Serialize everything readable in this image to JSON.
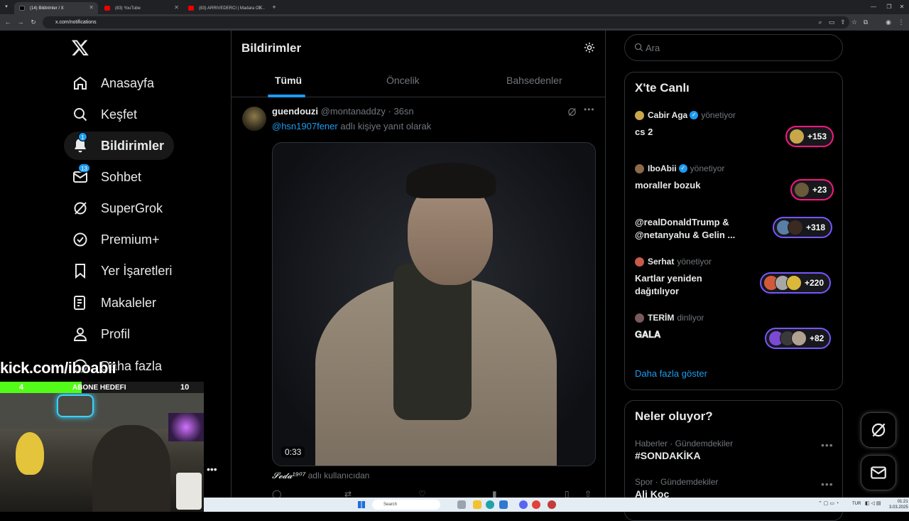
{
  "browser": {
    "tabs": [
      {
        "title": "(14) Bildirimler / X"
      },
      {
        "title": "(83) YouTube"
      },
      {
        "title": "(83) ARRIVEDERCI | Madara OL..."
      }
    ],
    "url": "x.com/notifications"
  },
  "nav": {
    "logo": "X",
    "items": [
      {
        "label": "Anasayfa"
      },
      {
        "label": "Keşfet"
      },
      {
        "label": "Bildirimler",
        "badge": "1"
      },
      {
        "label": "Sohbet",
        "badge": "13"
      },
      {
        "label": "SuperGrok"
      },
      {
        "label": "Premium+"
      },
      {
        "label": "Yer İşaretleri"
      },
      {
        "label": "Makaleler"
      },
      {
        "label": "Profil"
      },
      {
        "label": "Daha fazla"
      }
    ]
  },
  "header": {
    "title": "Bildirimler",
    "tabs": [
      {
        "label": "Tümü"
      },
      {
        "label": "Öncelik"
      },
      {
        "label": "Bahsedenler"
      }
    ]
  },
  "post": {
    "name": "guendouzi",
    "handle": "@montanaddzy",
    "time": "· 36sn",
    "reply_to": "@hsn1907fener",
    "reply_suffix": "adlı kişiye yanıt olarak",
    "video_duration": "0:33",
    "footer_name": "𝓢𝓮𝓭𝓪¹⁹⁰⁷",
    "footer_suffix": "adlı kullanıcıdan"
  },
  "search": {
    "placeholder": "Ara"
  },
  "live": {
    "title": "X'te Canlı",
    "items": [
      {
        "host": "Cabir Aga",
        "verified": true,
        "role": "yönetiyor",
        "title": "cs 2",
        "count": "+153"
      },
      {
        "host": "IboAbii",
        "verified": true,
        "role": "yönetiyor",
        "title": "moraller bozuk",
        "count": "+23"
      },
      {
        "host": "",
        "verified": false,
        "role": "",
        "title_line1": "@realDonaldTrump  &",
        "title_line2": "@netanyahu & Gelin ...",
        "count": "+318"
      },
      {
        "host": "Serhat",
        "verified": false,
        "role": "yönetiyor",
        "title_line1": "Kartlar yeniden",
        "title_line2": "dağıtılıyor",
        "count": "+220"
      },
      {
        "host": "TERİM",
        "verified": false,
        "role": "dinliyor",
        "title": "𝐆𝐀𝐋𝐀",
        "count": "+82"
      }
    ],
    "more": "Daha fazla göster"
  },
  "trends": {
    "title": "Neler oluyor?",
    "items": [
      {
        "meta": "Haberler · Gündemdekiler",
        "name": "#SONDAKİKA"
      },
      {
        "meta": "Spor · Gündemdekiler",
        "name": "Ali Koç"
      }
    ]
  },
  "overlay": {
    "kick": "kick.com/iboabii",
    "goal_left": "4",
    "goal_label": "ABONE HEDEFI",
    "goal_right": "10"
  },
  "taskbar": {
    "search": "Search",
    "lang": "TUR",
    "time": "01:21",
    "date": "3.03.2025"
  },
  "colors": {
    "accent": "#1d9bf0",
    "live_pink": "#f91880",
    "live_purple": "#7856ff"
  }
}
